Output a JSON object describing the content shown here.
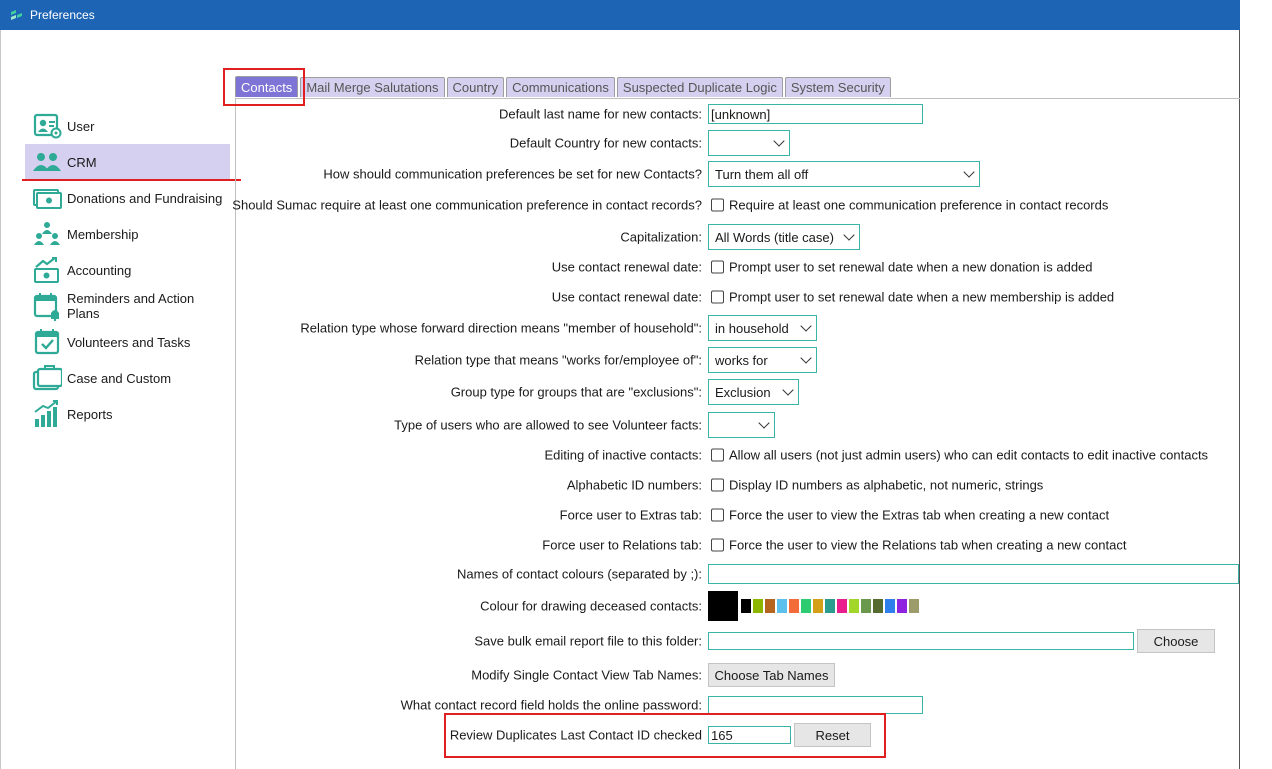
{
  "window": {
    "title": "Preferences"
  },
  "tabs": [
    {
      "label": "Contacts",
      "active": true
    },
    {
      "label": "Mail Merge Salutations",
      "active": false
    },
    {
      "label": "Country",
      "active": false
    },
    {
      "label": "Communications",
      "active": false
    },
    {
      "label": "Suspected Duplicate Logic",
      "active": false
    },
    {
      "label": "System Security",
      "active": false
    }
  ],
  "sidebar": {
    "items": [
      {
        "label": "User",
        "icon": "user-card-icon"
      },
      {
        "label": "CRM",
        "icon": "people-icon",
        "active": true
      },
      {
        "label": "Donations and Fundraising",
        "icon": "money-icon"
      },
      {
        "label": "Membership",
        "icon": "membership-icon"
      },
      {
        "label": "Accounting",
        "icon": "accounting-icon"
      },
      {
        "label": "Reminders and Action Plans",
        "icon": "calendar-bell-icon"
      },
      {
        "label": "Volunteers and Tasks",
        "icon": "calendar-check-icon"
      },
      {
        "label": "Case and Custom",
        "icon": "briefcase-icon"
      },
      {
        "label": "Reports",
        "icon": "bar-chart-icon"
      }
    ]
  },
  "form": {
    "default_last_name": {
      "label": "Default last name for new contacts:",
      "value": "[unknown]"
    },
    "default_country": {
      "label": "Default Country for new contacts:",
      "value": ""
    },
    "comm_prefs": {
      "label": "How should communication preferences be set for new Contacts?",
      "value": "Turn them all off"
    },
    "require_comm": {
      "label": "Should Sumac require at least one communication preference in contact records?",
      "checkbox": "Require at least one communication preference in contact records"
    },
    "capitalization": {
      "label": "Capitalization:",
      "value": "All Words (title case)"
    },
    "renewal_donation": {
      "label": "Use contact renewal date:",
      "checkbox": "Prompt user to set renewal date when a new donation is added"
    },
    "renewal_membership": {
      "label": "Use contact renewal date:",
      "checkbox": "Prompt user to set renewal date when a new membership is added"
    },
    "household": {
      "label": "Relation type whose forward direction means \"member of household\":",
      "value": "in household"
    },
    "works_for": {
      "label": "Relation type that means \"works for/employee of\":",
      "value": "works for"
    },
    "exclusions": {
      "label": "Group type for groups that are \"exclusions\":",
      "value": "Exclusion"
    },
    "volunteer_facts": {
      "label": "Type of users who are allowed to see Volunteer facts:",
      "value": ""
    },
    "inactive": {
      "label": "Editing of inactive contacts:",
      "checkbox": "Allow all users (not just admin users) who can edit contacts to edit inactive contacts"
    },
    "alpha_id": {
      "label": "Alphabetic ID numbers:",
      "checkbox": "Display ID numbers as alphabetic, not numeric, strings"
    },
    "extras_tab": {
      "label": "Force user to Extras tab:",
      "checkbox": "Force the user to view the Extras tab when creating a new contact"
    },
    "relations_tab": {
      "label": "Force user to Relations tab:",
      "checkbox": "Force the user to view the Relations tab when creating a new contact"
    },
    "colour_names": {
      "label": "Names of contact colours (separated by ;):",
      "value": ""
    },
    "deceased_colour": {
      "label": "Colour for drawing deceased contacts:",
      "selected": "#000000",
      "palette": [
        "#000000",
        "#8db600",
        "#b5651d",
        "#5bc0eb",
        "#f26b38",
        "#2ecc71",
        "#d4a017",
        "#2a9d8f",
        "#e91e8c",
        "#a2d729",
        "#6a994e",
        "#556b2f",
        "#2f80ed",
        "#8e24e0",
        "#9c9c6a"
      ]
    },
    "bulk_email_folder": {
      "label": "Save bulk email report file to this folder:",
      "value": "",
      "button": "Choose"
    },
    "tab_names": {
      "label": "Modify Single Contact View Tab Names:",
      "button": "Choose Tab Names"
    },
    "online_password": {
      "label": "What contact record field holds the online password:",
      "value": ""
    },
    "review_duplicates": {
      "label": "Review Duplicates Last Contact ID checked",
      "value": "165",
      "button": "Reset"
    }
  }
}
